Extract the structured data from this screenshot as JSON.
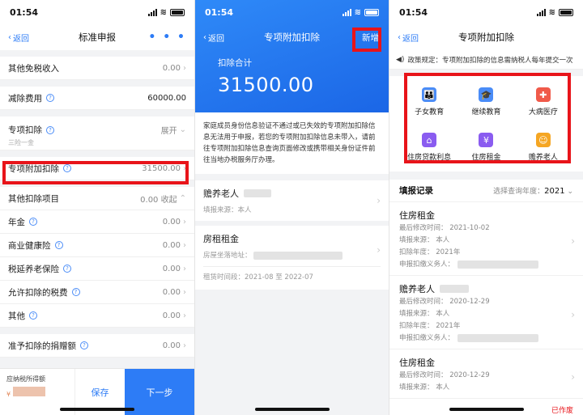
{
  "panel1": {
    "status": {
      "time": "01:54"
    },
    "nav": {
      "back": "返回",
      "title": "标准申报",
      "more": "• • •"
    },
    "rows": [
      {
        "label": "其他免税收入",
        "value": "0.00"
      },
      {
        "label": "减除费用",
        "value": "60000.00"
      },
      {
        "label": "专项扣除",
        "value": "展开",
        "sub": "三险一金"
      },
      {
        "label": "专项附加扣除",
        "value": "31500.00"
      },
      {
        "label": "其他扣除项目",
        "value": "0.00 收起"
      },
      {
        "label": "年金",
        "value": "0.00"
      },
      {
        "label": "商业健康险",
        "value": "0.00"
      },
      {
        "label": "税延养老保险",
        "value": "0.00"
      },
      {
        "label": "允许扣除的税费",
        "value": "0.00"
      },
      {
        "label": "其他",
        "value": "0.00"
      },
      {
        "label": "准予扣除的捐赠额",
        "value": "0.00"
      }
    ],
    "bottom": {
      "tax_label": "应纳税所得额",
      "currency": "¥",
      "save": "保存",
      "next": "下一步"
    }
  },
  "panel2": {
    "status": {
      "time": "01:54"
    },
    "nav": {
      "back": "返回",
      "title": "专项附加扣除",
      "add": "新增"
    },
    "total": {
      "label": "扣除合计",
      "amount": "31500.00"
    },
    "notice": "家庭成员身份信息验证不通过或已失效的专项附加扣除信息无法用于申报，若您的专项附加扣除信息未带入，请前往专项附加扣除信息查询页面修改或携带相关身份证件前往当地办税服务厅办理。",
    "cards": [
      {
        "name": "赡养老人",
        "meta": "填报来源：本人"
      },
      {
        "name": "房租租金",
        "meta": "房屋坐落地址：",
        "meta2": "租赁时间段：2021-08 至 2022-07"
      }
    ]
  },
  "panel3": {
    "status": {
      "time": "01:54"
    },
    "nav": {
      "back": "返回",
      "title": "专项附加扣除"
    },
    "policy": "政策规定：专项附加扣除的信息需纳税人每年提交一次",
    "categories": [
      {
        "label": "子女教育",
        "icon": "children-education-icon",
        "color": "#4a8cf7",
        "glyph": "👪"
      },
      {
        "label": "继续教育",
        "icon": "graduation-cap-icon",
        "color": "#4a8cf7",
        "glyph": "🎓"
      },
      {
        "label": "大病医疗",
        "icon": "medical-kit-icon",
        "color": "#f05a4a",
        "glyph": "✚"
      },
      {
        "label": "住房贷款利息",
        "icon": "house-loan-icon",
        "color": "#8a5cf0",
        "glyph": "⌂"
      },
      {
        "label": "住房租金",
        "icon": "house-rent-icon",
        "color": "#8a5cf0",
        "glyph": "¥"
      },
      {
        "label": "赡养老人",
        "icon": "elderly-support-icon",
        "color": "#f5a623",
        "glyph": "☺"
      }
    ],
    "records": {
      "title": "填报记录",
      "year_label": "选择查询年度：",
      "year": "2021",
      "items": [
        {
          "name": "住房租金",
          "lines": [
            "最后修改时间：  2021-10-02",
            "填报来源：  本人",
            "扣除年度：  2021年",
            "申报扣缴义务人："
          ]
        },
        {
          "name": "赡养老人",
          "lines": [
            "最后修改时间：  2020-12-29",
            "填报来源：  本人",
            "扣除年度：  2021年",
            "申报扣缴义务人："
          ]
        },
        {
          "name": "住房租金",
          "lines": [
            "最后修改时间：  2020-12-29",
            "填报来源：  本人"
          ]
        }
      ],
      "void": "已作废"
    }
  }
}
